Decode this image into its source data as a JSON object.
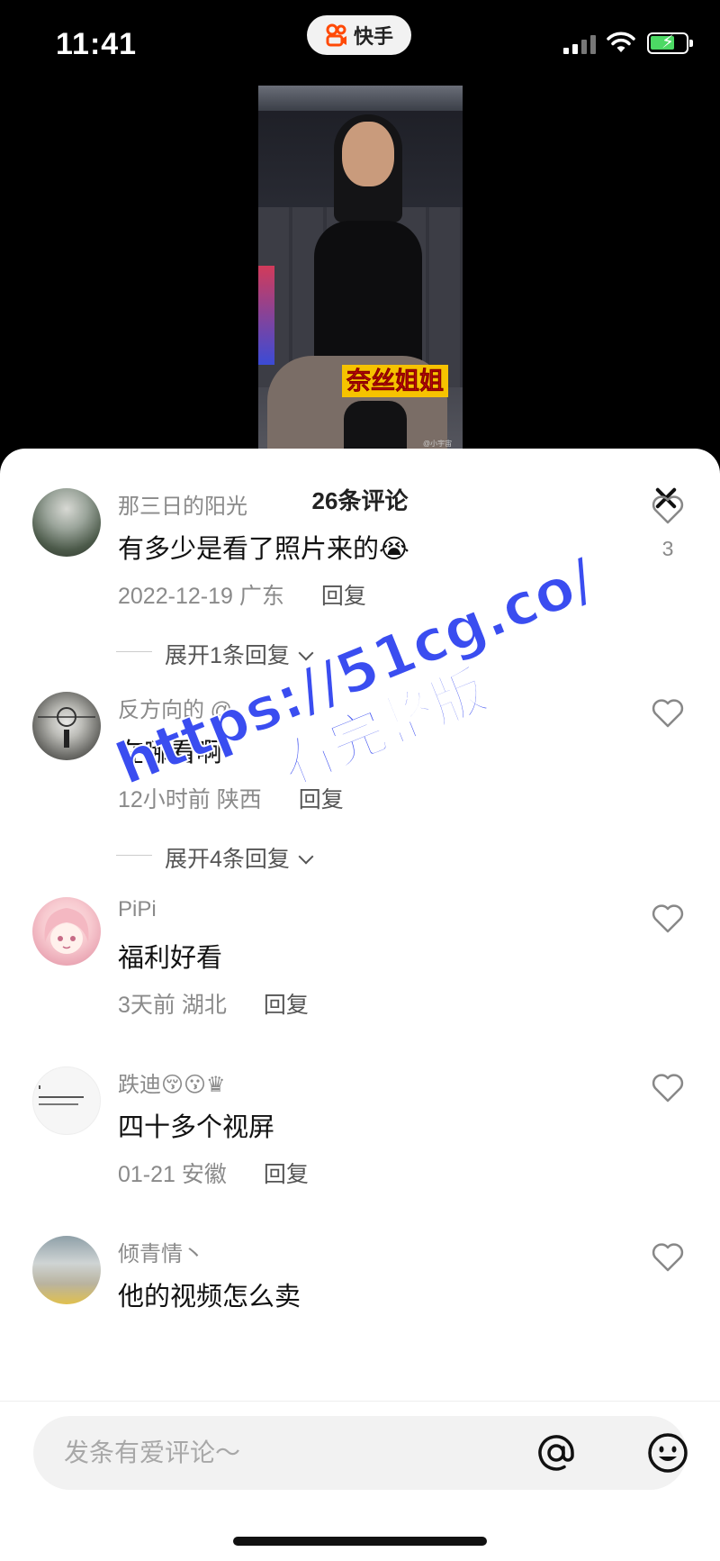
{
  "status_bar": {
    "time": "11:41",
    "app_name": "快手"
  },
  "video": {
    "caption": "奈丝姐姐",
    "watermark": "@小宇宙_Nice"
  },
  "comments_panel": {
    "title": "26条评论",
    "comments": [
      {
        "user": "那三日的阳光",
        "text": "有多少是看了照片来的😭",
        "date": "2022-12-19",
        "location": "广东",
        "reply_label": "回复",
        "likes": "3",
        "expand_label": "展开1条回复"
      },
      {
        "user": "反方向的 @",
        "text": "在哪看啊",
        "date": "12小时前",
        "location": "陕西",
        "reply_label": "回复",
        "expand_label": "展开4条回复"
      },
      {
        "user": "PiPi",
        "text": "福利好看",
        "date": "3天前",
        "location": "湖北",
        "reply_label": "回复"
      },
      {
        "user": "跌迪😚😗♛",
        "text": "四十多个视屏",
        "date": "01-21",
        "location": "安徽",
        "reply_label": "回复"
      },
      {
        "user": "倾青情丶",
        "text": "他的视频怎么卖"
      }
    ]
  },
  "watermark_overlay": {
    "line1": "https://51cg.co/",
    "line2": "看完整版"
  },
  "input": {
    "placeholder": "发条有爱评论～"
  },
  "colors": {
    "watermark": "#3a4df0",
    "battery_fill": "#4cd964",
    "caption_bg": "#f6c300",
    "caption_text": "#e01010"
  }
}
